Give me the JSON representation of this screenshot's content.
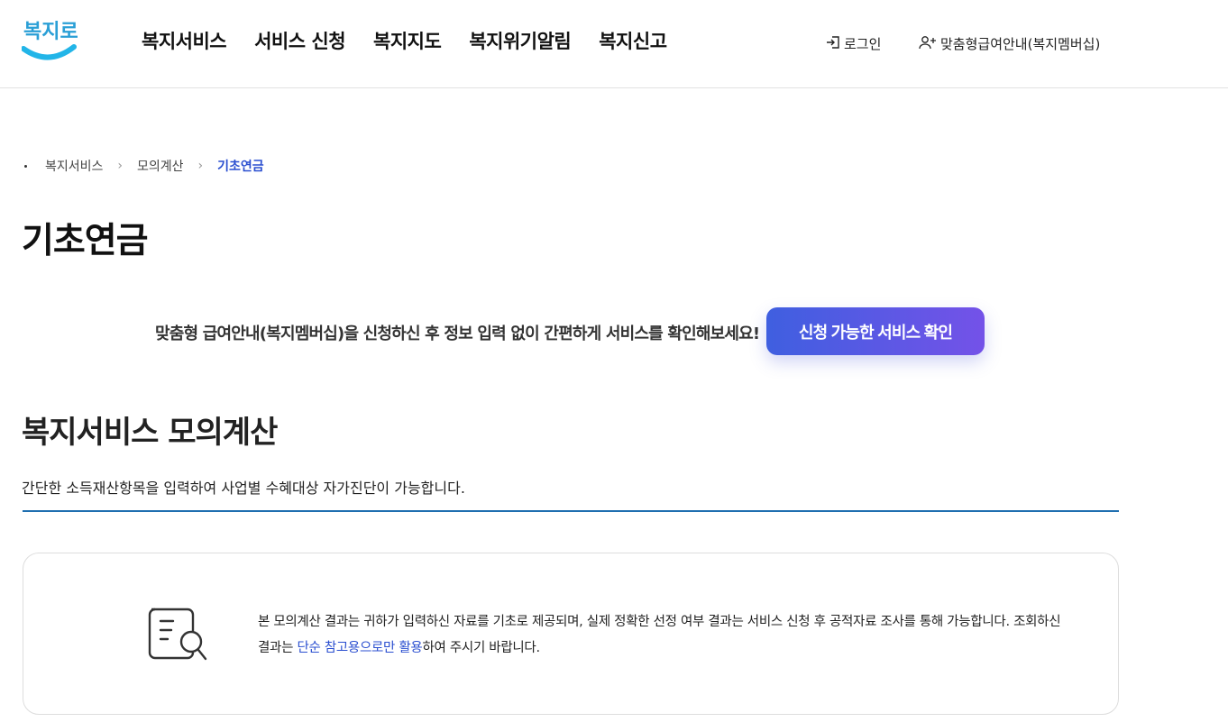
{
  "header": {
    "logo_alt": "복지로",
    "nav": [
      "복지서비스",
      "서비스 신청",
      "복지지도",
      "복지위기알림",
      "복지신고"
    ],
    "login": "로그인",
    "member": "맞춤형급여안내(복지멤버십)"
  },
  "breadcrumb": [
    "복지서비스",
    "모의계산",
    "기초연금"
  ],
  "page_title": "기초연금",
  "promo": {
    "text": "맞춤형 급여안내(복지멤버십)을 신청하신 후 정보 입력 없이 간편하게 서비스를 확인해보세요!",
    "button": "신청 가능한 서비스 확인"
  },
  "section": {
    "title": "복지서비스 모의계산",
    "desc": "간단한 소득재산항목을 입력하여 사업별 수혜대상 자가진단이 가능합니다."
  },
  "notice": {
    "text_1": "본 모의계산 결과는 귀하가 입력하신 자료를 기초로 제공되며, 실제 정확한 선정 여부 결과는 서비스 신청 후 공적자료 조사를 통해 가능합니다. 조회하신 결과는 ",
    "highlight": "단순 참고용으로만 활용",
    "text_2": "하여 주시기 바랍니다."
  },
  "colors": {
    "accent": "#2b4fd0",
    "button_start": "#3f5fe0",
    "button_end": "#7452e8",
    "divider": "#1f6fb0"
  },
  "icons": [
    "logo",
    "login-icon",
    "user-plus-icon",
    "document-search-icon",
    "chevron-right-icon"
  ]
}
